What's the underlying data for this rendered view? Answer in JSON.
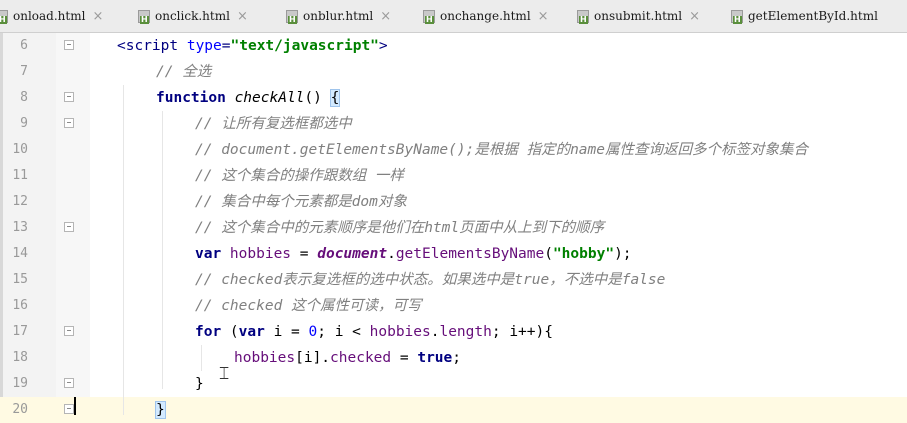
{
  "tabs": [
    {
      "label": "onload.html",
      "icon": "html-file-icon"
    },
    {
      "label": "onclick.html",
      "icon": "html-file-icon"
    },
    {
      "label": "onblur.html",
      "icon": "html-file-icon"
    },
    {
      "label": "onchange.html",
      "icon": "html-file-icon"
    },
    {
      "label": "onsubmit.html",
      "icon": "html-file-icon"
    },
    {
      "label": "getElementById.html",
      "icon": "html-file-icon"
    }
  ],
  "close_glyph": "×",
  "editor": {
    "lines": [
      {
        "num": "6",
        "tokens": [
          [
            "tag",
            "<script "
          ],
          [
            "attr",
            "type"
          ],
          [
            "tag",
            "="
          ],
          [
            "str",
            "\"text/javascript\""
          ],
          [
            "tag",
            ">"
          ]
        ]
      },
      {
        "num": "7",
        "tokens": [
          [
            "cmt",
            "// 全选"
          ]
        ]
      },
      {
        "num": "8",
        "tokens": [
          [
            "kw",
            "function "
          ],
          [
            "fn",
            "checkAll"
          ],
          [
            "",
            "() "
          ],
          [
            "bmatch",
            "{"
          ]
        ]
      },
      {
        "num": "9",
        "tokens": [
          [
            "cmt",
            "// 让所有复选框都选中"
          ]
        ]
      },
      {
        "num": "10",
        "tokens": [
          [
            "cmt",
            "// document.getElementsByName();是根据 指定的name属性查询返回多个标签对象集合"
          ]
        ]
      },
      {
        "num": "11",
        "tokens": [
          [
            "cmt",
            "// 这个集合的操作跟数组 一样"
          ]
        ]
      },
      {
        "num": "12",
        "tokens": [
          [
            "cmt",
            "// 集合中每个元素都是dom对象"
          ]
        ]
      },
      {
        "num": "13",
        "tokens": [
          [
            "cmt",
            "// 这个集合中的元素顺序是他们在html页面中从上到下的顺序"
          ]
        ]
      },
      {
        "num": "14",
        "tokens": [
          [
            "kw",
            "var "
          ],
          [
            "prop",
            "hobbies"
          ],
          [
            "",
            " = "
          ],
          [
            "glob",
            "document"
          ],
          [
            "",
            "."
          ],
          [
            "prop",
            "getElementsByName"
          ],
          [
            "",
            "("
          ],
          [
            "str",
            "\"hobby\""
          ],
          [
            "",
            ");"
          ]
        ]
      },
      {
        "num": "15",
        "tokens": [
          [
            "cmt",
            "// checked表示复选框的选中状态。如果选中是true，不选中是false"
          ]
        ]
      },
      {
        "num": "16",
        "tokens": [
          [
            "cmt",
            "// checked 这个属性可读，可写"
          ]
        ]
      },
      {
        "num": "17",
        "tokens": [
          [
            "kw",
            "for "
          ],
          [
            "",
            "("
          ],
          [
            "kw",
            "var "
          ],
          [
            "",
            "i = "
          ],
          [
            "num",
            "0"
          ],
          [
            "",
            "; i < "
          ],
          [
            "prop",
            "hobbies"
          ],
          [
            "",
            "."
          ],
          [
            "prop",
            "length"
          ],
          [
            "",
            "; i++){"
          ]
        ]
      },
      {
        "num": "18",
        "tokens": [
          [
            "prop",
            "hobbies"
          ],
          [
            "",
            "[i]."
          ],
          [
            "prop",
            "checked"
          ],
          [
            "",
            " = "
          ],
          [
            "kw",
            "true"
          ],
          [
            "",
            ";"
          ]
        ]
      },
      {
        "num": "19",
        "tokens": [
          [
            "",
            "}"
          ]
        ]
      },
      {
        "num": "20",
        "tokens": [
          [
            "bmatch",
            "}"
          ]
        ]
      }
    ]
  }
}
